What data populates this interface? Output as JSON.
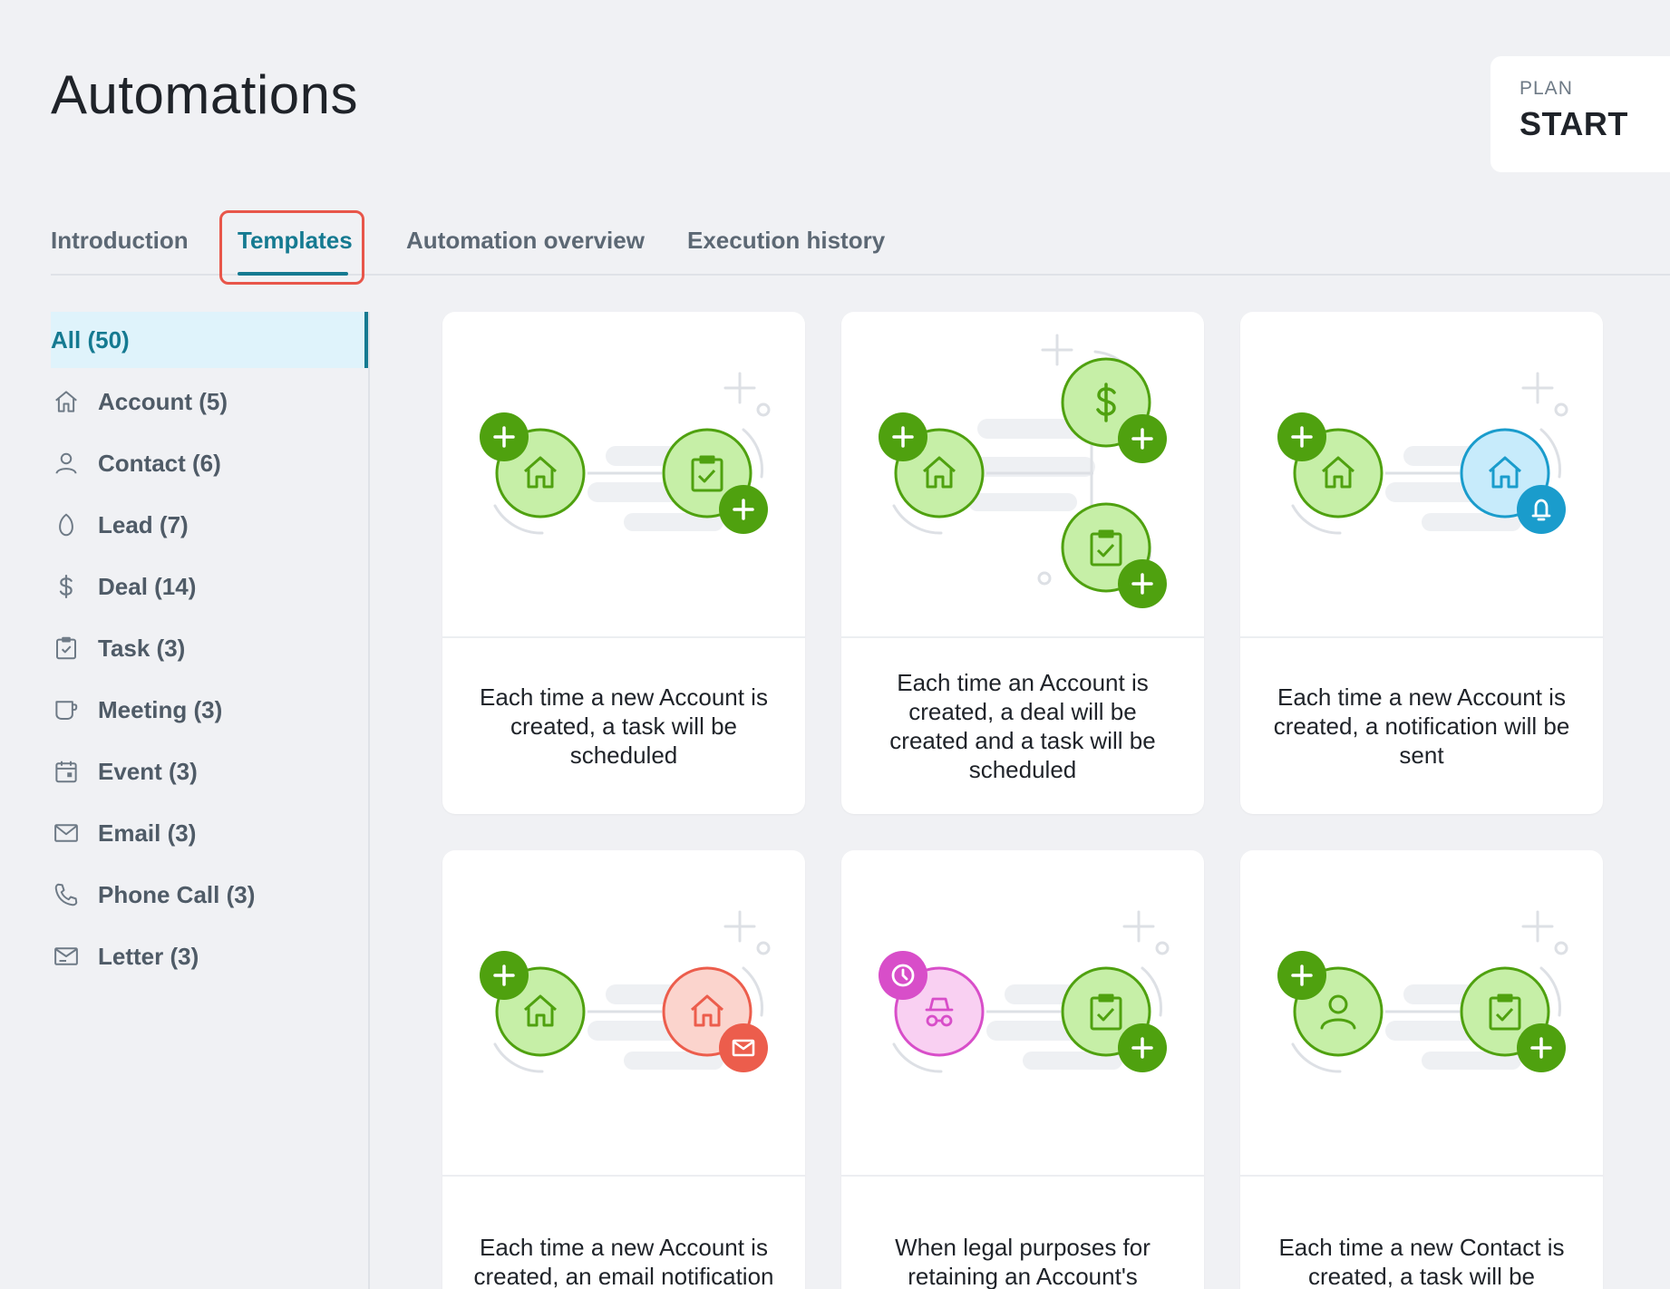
{
  "page": {
    "title": "Automations"
  },
  "plan": {
    "label": "PLAN",
    "value": "START"
  },
  "tabs": [
    {
      "label": "Introduction",
      "active": false
    },
    {
      "label": "Templates",
      "active": true
    },
    {
      "label": "Automation overview",
      "active": false
    },
    {
      "label": "Execution history",
      "active": false
    }
  ],
  "sidebar": {
    "items": [
      {
        "label": "All (50)",
        "icon": "none",
        "active": true
      },
      {
        "label": "Account (5)",
        "icon": "house-icon"
      },
      {
        "label": "Contact (6)",
        "icon": "person-icon"
      },
      {
        "label": "Lead (7)",
        "icon": "lead-icon"
      },
      {
        "label": "Deal (14)",
        "icon": "dollar-icon"
      },
      {
        "label": "Task (3)",
        "icon": "task-icon"
      },
      {
        "label": "Meeting (3)",
        "icon": "meeting-icon"
      },
      {
        "label": "Event (3)",
        "icon": "calendar-icon"
      },
      {
        "label": "Email (3)",
        "icon": "email-icon"
      },
      {
        "label": "Phone Call (3)",
        "icon": "phone-icon"
      },
      {
        "label": "Letter (3)",
        "icon": "letter-icon"
      }
    ]
  },
  "colors": {
    "accent": "#157a91",
    "active_bg": "#dff3fb",
    "highlight_border": "#e8564a",
    "green_dark": "#4fa10f",
    "green_light": "#c6efa7",
    "blue_light": "#c7ebfb",
    "blue_dark": "#1a9ccc",
    "red_light": "#fbd4cd",
    "red_dark": "#ec5d4c",
    "pink_light": "#f9d0f2",
    "pink_dark": "#d84ec9"
  },
  "templates": [
    {
      "text": "Each time a new Account is created, a task will be scheduled"
    },
    {
      "text": "Each time an Account is created, a deal will be created and a task will be scheduled"
    },
    {
      "text": "Each time a new Account is created, a notification will be sent"
    },
    {
      "text": "Each time a new Account is created, an email notification will be sent"
    },
    {
      "text": "When legal purposes for retaining an Account's personal data expire, a task will be scheduled"
    },
    {
      "text": "Each time a new Contact is created, a task will be scheduled"
    }
  ]
}
